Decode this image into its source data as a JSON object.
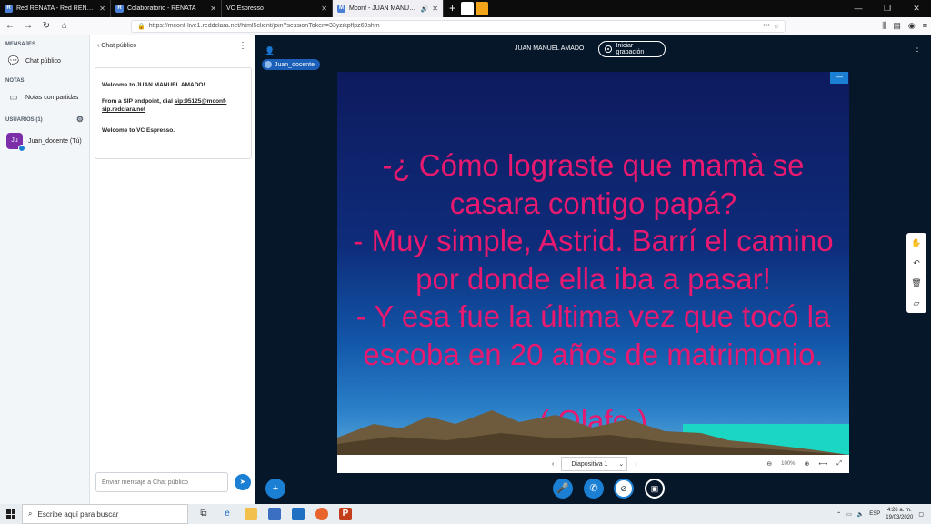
{
  "browser": {
    "tabs": [
      {
        "label": "Red RENATA - Red RENATA Red",
        "active": false
      },
      {
        "label": "Colaboratorio - RENATA",
        "active": false
      },
      {
        "label": "VC Espresso",
        "active": false
      },
      {
        "label": "Mconf - JUAN MANUEL AMADO",
        "active": true
      }
    ],
    "url": "https://mconf-live1.reddclara.net/html5client/join?sessionToken=33yzikpflpz69shm"
  },
  "left_panel": {
    "messages_title": "MENSAJES",
    "public_chat": "Chat público",
    "notes_title": "NOTAS",
    "shared_notes": "Notas compartidas",
    "users_title": "USUARIOS (1)",
    "user": {
      "initials": "Ju",
      "name": "Juan_docente (Tú)"
    }
  },
  "chat": {
    "header": "Chat público",
    "welcome_line1": "Welcome to JUAN MANUEL AMADO!",
    "welcome_line2": "From a SIP endpoint, dial",
    "welcome_link": "sip:95125@mconf-sip.redclara.net",
    "welcome_line3": "Welcome to VC Espresso.",
    "input_placeholder": "Enviar mensaje a Chat público"
  },
  "stage": {
    "meeting_title": "JUAN MANUEL AMADO",
    "record_label": "Iniciar grabación",
    "presenter_name": "Juan_docente",
    "slide_lines": [
      "-¿ Cómo lograste que mamà se",
      "casara contigo papá?",
      "- Muy simple, Astrid. Barrí el camino",
      "por donde ella iba a pasar!",
      "- Y esa fue la última vez que tocó la",
      "escoba en 20 años de matrimonio."
    ],
    "slide_signature": "( Olafo )",
    "slide_select": "Diapositiva 1",
    "zoom": "100%"
  },
  "taskbar": {
    "search_placeholder": "Escribe aquí para buscar",
    "lang": "ESP",
    "time": "4:26 a. m.",
    "date": "19/03/2020"
  },
  "colors": {
    "accent": "#1b7fd4",
    "slide_text": "#e8196e",
    "stage_bg": "#06172a"
  }
}
